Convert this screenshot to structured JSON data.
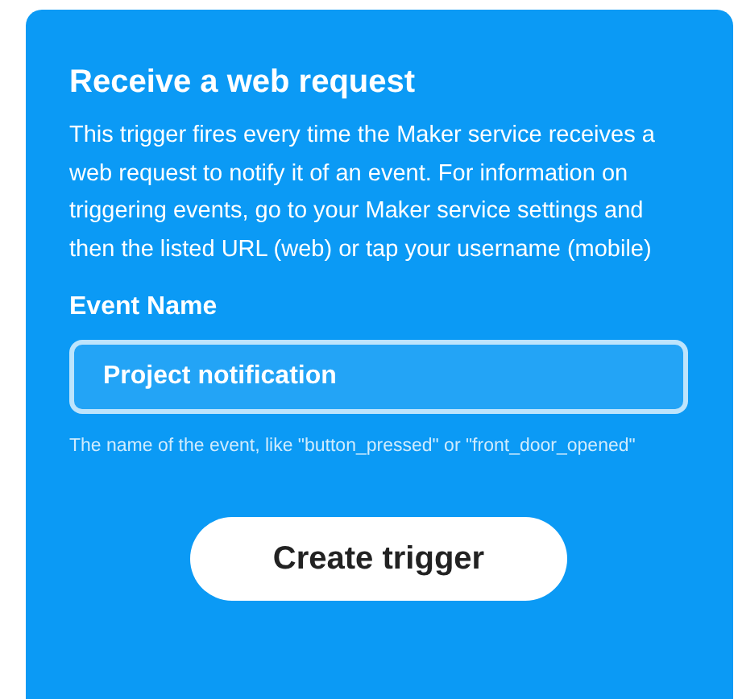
{
  "card": {
    "title": "Receive a web request",
    "description": "This trigger fires every time the Maker service receives a web request to notify it of an event. For information on triggering events, go to your Maker service settings and then the listed URL (web) or tap your username (mobile)",
    "field": {
      "label": "Event Name",
      "value": "Project notification",
      "help": "The name of the event, like \"button_pressed\" or \"front_door_opened\""
    },
    "button": "Create trigger"
  }
}
